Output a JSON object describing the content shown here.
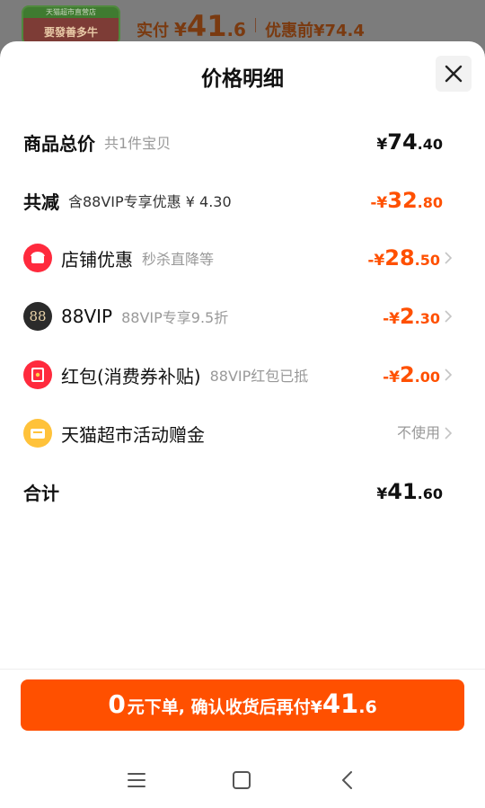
{
  "header": {
    "thumb_top_text": "天猫超市直营店",
    "thumb_body_text": "要發善多牛",
    "paid_label": "实付",
    "paid_yen": "¥",
    "paid_int": "41",
    "paid_dec": ".6",
    "before_label": "优惠前",
    "before_value": "¥74.4"
  },
  "sheet": {
    "title": "价格明细"
  },
  "rows": {
    "total": {
      "label": "商品总价",
      "sub": "共1件宝贝",
      "yen": "¥",
      "int": "74",
      "dec": ".40"
    },
    "reduce": {
      "label": "共减",
      "sub": "含88VIP专享优惠 ¥ 4.30",
      "yen": "-¥",
      "int": "32",
      "dec": ".80"
    },
    "shop": {
      "label": "店铺优惠",
      "sub": "秒杀直降等",
      "yen": "-¥",
      "int": "28",
      "dec": ".50"
    },
    "vip": {
      "label": "88VIP",
      "sub": "88VIP专享9.5折",
      "icon_text": "88",
      "yen": "-¥",
      "int": "2",
      "dec": ".30"
    },
    "redpack": {
      "label": "红包(消费券补贴)",
      "sub": "88VIP红包已抵",
      "yen": "-¥",
      "int": "2",
      "dec": ".00"
    },
    "tmall": {
      "label": "天猫超市活动赠金",
      "value": "不使用"
    },
    "sum": {
      "label": "合计",
      "yen": "¥",
      "int": "41",
      "dec": ".60"
    }
  },
  "cta": {
    "zero": "0",
    "text_a": "元下单, 确认收货后再付",
    "yen": "¥",
    "int": "41",
    "dec": ".6"
  },
  "colors": {
    "accent": "#ff5000",
    "shop_icon": "#ff2a3d",
    "vip_icon": "#2b2b2b",
    "redpack_icon": "#ff2a3d",
    "tmall_icon": "#ffc23a"
  },
  "icons": {
    "close": "close-icon",
    "chevron": "chevron-right-icon",
    "nav_menu": "menu-icon",
    "nav_home": "home-icon",
    "nav_back": "back-icon"
  }
}
